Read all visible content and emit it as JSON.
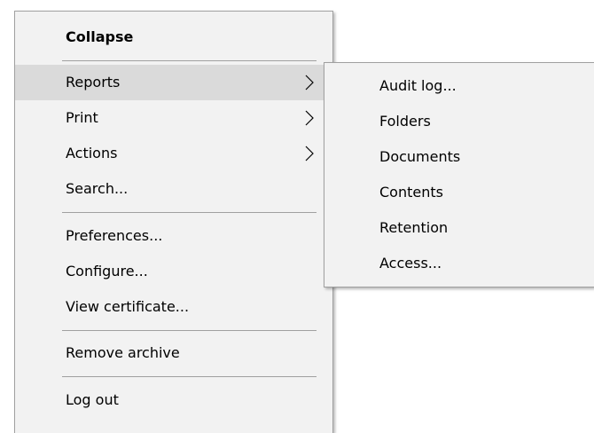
{
  "main_menu": {
    "items": [
      {
        "label": "Collapse"
      },
      {
        "label": "Reports"
      },
      {
        "label": "Print"
      },
      {
        "label": "Actions"
      },
      {
        "label": "Search..."
      },
      {
        "label": "Preferences..."
      },
      {
        "label": "Configure..."
      },
      {
        "label": "View certificate..."
      },
      {
        "label": "Remove archive"
      },
      {
        "label": "Log out"
      }
    ],
    "submenu_icon": "chevron-right-icon"
  },
  "sub_menu": {
    "parent": "Reports",
    "items": [
      {
        "label": "Audit log..."
      },
      {
        "label": "Folders"
      },
      {
        "label": "Documents"
      },
      {
        "label": "Contents"
      },
      {
        "label": "Retention"
      },
      {
        "label": "Access..."
      }
    ]
  },
  "colors": {
    "menu_background": "#f2f2f2",
    "highlight": "#dadada",
    "border": "#a0a0a0",
    "text": "#000000"
  }
}
